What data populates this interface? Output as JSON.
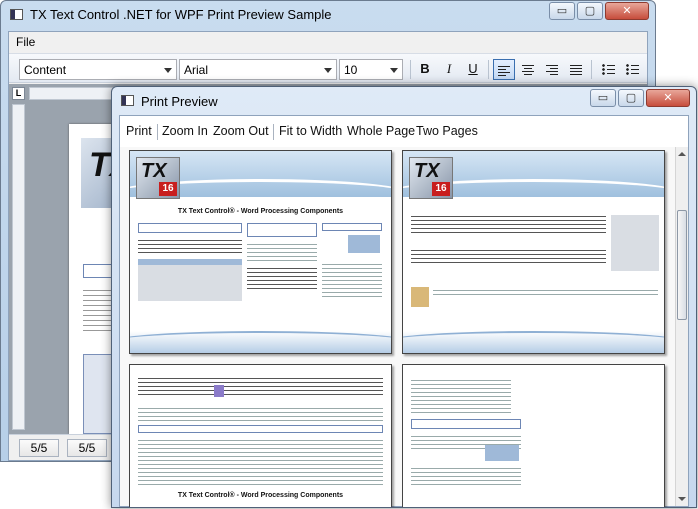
{
  "main_window": {
    "title": "TX Text Control .NET for WPF Print Preview Sample",
    "caption_buttons": {
      "minimize": "▭",
      "maximize": "▢",
      "close": "✕"
    },
    "menu": {
      "file": "File"
    },
    "toolbar": {
      "style_value": "Content",
      "font_value": "Arial",
      "size_value": "10",
      "bold_label": "B",
      "italic_label": "I",
      "underline_label": "U"
    },
    "ruler_corner_label": "L",
    "status": {
      "cell1": "5/5",
      "cell2": "5/5"
    }
  },
  "print_preview": {
    "title": "Print Preview",
    "caption_buttons": {
      "minimize": "▭",
      "maximize": "▢",
      "close": "✕"
    },
    "commands": [
      "Print",
      "Zoom In",
      "Zoom Out",
      "Fit to Width",
      "Whole Page",
      "Two Pages"
    ],
    "pages": [
      {
        "logo_text": "TX",
        "logo_number": "16",
        "heading": "TX Text Control® - Word Processing Components"
      },
      {
        "logo_text": "TX",
        "logo_number": "16",
        "heading": ""
      },
      {
        "logo_text": "",
        "logo_number": "",
        "heading": "TX Text Control® - Word Processing Components"
      },
      {
        "logo_text": "",
        "logo_number": "",
        "heading": ""
      }
    ]
  }
}
